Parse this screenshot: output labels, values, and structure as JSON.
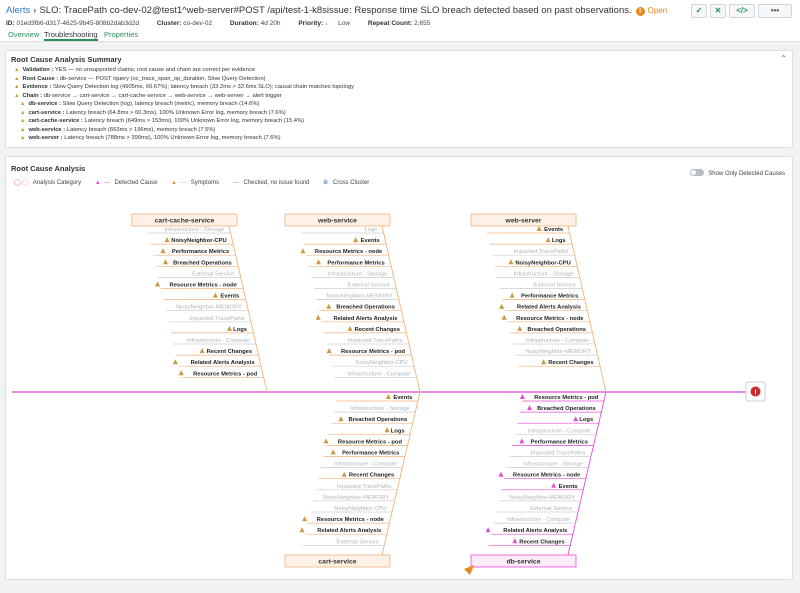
{
  "header": {
    "breadcrumb_link": "Alerts",
    "title": "SLO: TracePath co-dev-02@test1^web-server#POST /api/test-1-k8sissue: Response time SLO breach detected based on past observations.",
    "status": "Open",
    "meta": {
      "id_label": "ID:",
      "id_value": "01ed3fb6-d317-4625-9b45-808b2dab3d2d",
      "cluster_label": "Cluster:",
      "cluster_value": "co-dev-02",
      "duration_label": "Duration:",
      "duration_value": "4d 20h",
      "priority_label": "Priority:",
      "priority_value": "Low",
      "repeat_label": "Repeat Count:",
      "repeat_value": "2,655"
    },
    "actions": {
      "check": "✓",
      "close": "✕",
      "code": "</>",
      "more": "•••"
    }
  },
  "tabs": [
    "Overview",
    "Troubleshooting",
    "Properties"
  ],
  "summary": {
    "title": "Root Cause Analysis Summary",
    "lines": [
      {
        "label": "Validation :",
        "text": "YES — no unsupported claims; root cause and chain are correct per evidence"
      },
      {
        "label": "Root Cause :",
        "text": "db-service — POST /query (oc_trace_span_op_duration, Slow Query Detection)"
      },
      {
        "label": "Evidence :",
        "text": "Slow Query Detection log (4905ms, 66.67%); latency breach (33.2ms > 32.6ms SLO); causal chain matches topology"
      },
      {
        "label": "Chain :",
        "text": "db-service → cart-service → cart-cache-service → web-service → web-server → alert trigger"
      },
      {
        "label": "db-service :",
        "text": "Slow Query Detection (log), latency breach (metric), memory breach (14.6%)"
      },
      {
        "label": "cart-service :",
        "text": "Latency breach (64.8ms > 60.3ms), 100% Unknown Error log, memory breach (7.6%)"
      },
      {
        "label": "cart-cache-service :",
        "text": "Latency breach (649ms > 153ms), 100% Unknown Error log, memory breach (15.4%)"
      },
      {
        "label": "web-service :",
        "text": "Latency breach (663ms > 196ms), memory breach (7.5%)"
      },
      {
        "label": "web-server :",
        "text": "Latency breach (788ms > 390ms), 100% Unknown Error log, memory breach (7.6%)"
      }
    ]
  },
  "rca": {
    "title": "Root Cause Analysis",
    "legend": {
      "category": "Analysis Category",
      "detected": "Detected Cause",
      "symptoms": "Symptoms",
      "checked": "Checked, no issue found",
      "cross": "Cross Cluster"
    },
    "toggle_label": "Show Only Detected Causes",
    "colors": {
      "orange": "#f2b27c",
      "pink": "#e44fd0",
      "spine": "#d84ad8",
      "bell": "#c99a3f",
      "grey": "#aeb5bc"
    },
    "branches": [
      {
        "name": "cart-cache-service",
        "items": [
          {
            "t": "Infrastructure - Storage",
            "s": "n"
          },
          {
            "t": "NoisyNeighbor-CPU",
            "s": "s"
          },
          {
            "t": "Performance Metrics",
            "s": "s"
          },
          {
            "t": "Breached Operations",
            "s": "s"
          },
          {
            "t": "External Service",
            "s": "n"
          },
          {
            "t": "Resource Metrics - node",
            "s": "s"
          },
          {
            "t": "Events",
            "s": "s"
          },
          {
            "t": "NoisyNeighbor-MEMORY",
            "s": "n"
          },
          {
            "t": "Impacted TracePaths",
            "s": "n"
          },
          {
            "t": "Logs",
            "s": "s"
          },
          {
            "t": "Infrastructure - Compute",
            "s": "n"
          },
          {
            "t": "Recent Changes",
            "s": "s"
          },
          {
            "t": "Related Alerts Analysis",
            "s": "s"
          },
          {
            "t": "Resource Metrics - pod",
            "s": "s"
          }
        ]
      },
      {
        "name": "web-service",
        "items": [
          {
            "t": "Logs",
            "s": "n"
          },
          {
            "t": "Events",
            "s": "s"
          },
          {
            "t": "Resource Metrics - node",
            "s": "s"
          },
          {
            "t": "Performance Metrics",
            "s": "s"
          },
          {
            "t": "Infrastructure - Storage",
            "s": "n"
          },
          {
            "t": "External Service",
            "s": "n"
          },
          {
            "t": "NoisyNeighbor-MEMORY",
            "s": "n"
          },
          {
            "t": "Breached Operations",
            "s": "s"
          },
          {
            "t": "Related Alerts Analysis",
            "s": "s"
          },
          {
            "t": "Recent Changes",
            "s": "s"
          },
          {
            "t": "Impacted TracePaths",
            "s": "n"
          },
          {
            "t": "Resource Metrics - pod",
            "s": "s"
          },
          {
            "t": "NoisyNeighbor-CPU",
            "s": "n"
          },
          {
            "t": "Infrastructure - Compute",
            "s": "n"
          }
        ]
      },
      {
        "name": "web-server",
        "items": [
          {
            "t": "Events",
            "s": "s"
          },
          {
            "t": "Logs",
            "s": "s"
          },
          {
            "t": "Impacted TracePaths",
            "s": "n"
          },
          {
            "t": "NoisyNeighbor-CPU",
            "s": "s"
          },
          {
            "t": "Infrastructure - Storage",
            "s": "n"
          },
          {
            "t": "External Service",
            "s": "n"
          },
          {
            "t": "Performance Metrics",
            "s": "s"
          },
          {
            "t": "Related Alerts Analysis",
            "s": "s"
          },
          {
            "t": "Resource Metrics - node",
            "s": "s"
          },
          {
            "t": "Breached Operations",
            "s": "s"
          },
          {
            "t": "Infrastructure - Compute",
            "s": "n"
          },
          {
            "t": "NoisyNeighbor-MEMORY",
            "s": "n"
          },
          {
            "t": "Recent Changes",
            "s": "s"
          }
        ]
      },
      {
        "name": "cart-service",
        "items": [
          {
            "t": "Events",
            "s": "s"
          },
          {
            "t": "Infrastructure - Storage",
            "s": "n"
          },
          {
            "t": "Breached Operations",
            "s": "s"
          },
          {
            "t": "Logs",
            "s": "s"
          },
          {
            "t": "Resource Metrics - pod",
            "s": "s"
          },
          {
            "t": "Performance Metrics",
            "s": "s"
          },
          {
            "t": "Infrastructure - Compute",
            "s": "n"
          },
          {
            "t": "Recent Changes",
            "s": "s"
          },
          {
            "t": "Impacted TracePaths",
            "s": "n"
          },
          {
            "t": "NoisyNeighbor-MEMORY",
            "s": "n"
          },
          {
            "t": "NoisyNeighbor-CPU",
            "s": "n"
          },
          {
            "t": "Resource Metrics - node",
            "s": "s"
          },
          {
            "t": "Related Alerts Analysis",
            "s": "s"
          },
          {
            "t": "External Service",
            "s": "n"
          }
        ]
      },
      {
        "name": "db-service",
        "items": [
          {
            "t": "Resource Metrics - pod",
            "s": "d"
          },
          {
            "t": "Breached Operations",
            "s": "d"
          },
          {
            "t": "Logs",
            "s": "d"
          },
          {
            "t": "Infrastructure - Compute",
            "s": "n"
          },
          {
            "t": "Performance Metrics",
            "s": "d"
          },
          {
            "t": "Impacted TracePaths",
            "s": "n"
          },
          {
            "t": "Infrastructure - Storage",
            "s": "n"
          },
          {
            "t": "Resource Metrics - node",
            "s": "d"
          },
          {
            "t": "Events",
            "s": "d"
          },
          {
            "t": "NoisyNeighbor-MEMORY",
            "s": "n"
          },
          {
            "t": "External Service",
            "s": "n"
          },
          {
            "t": "Infrastructure - Compute",
            "s": "n"
          },
          {
            "t": "Related Alerts Analysis",
            "s": "d"
          },
          {
            "t": "Recent Changes",
            "s": "d"
          }
        ]
      }
    ]
  }
}
